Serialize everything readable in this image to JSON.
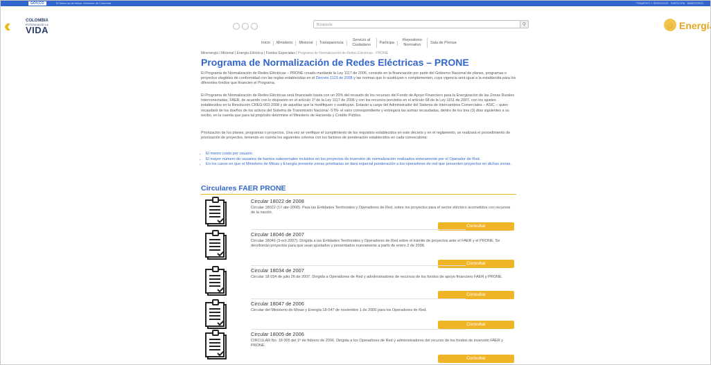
{
  "govbar": {
    "logo": "GOV.CO",
    "message": "El futuro es de todos. Gobierno de Colombia",
    "right": "TRÁMITES Y SERVICIOS · PARTICIPA · MINISTERIO"
  },
  "brand": {
    "line1": "COLOMBIA",
    "line2": "POTENCIA DE LA",
    "line3": "VIDA"
  },
  "search": {
    "placeholder": "Búsqueda"
  },
  "energia": {
    "word": "Energía"
  },
  "nav": [
    {
      "label": "Inicio"
    },
    {
      "label": "Ministerio"
    },
    {
      "label": "Misional"
    },
    {
      "label": "Transparencia"
    },
    {
      "label": "Servicio al Ciudadano"
    },
    {
      "label": "Participa"
    },
    {
      "label": "Repositorio Normativo"
    },
    {
      "label": "Sala de Prensa"
    }
  ],
  "breadcrumb": {
    "path": "Minenergía | Misional | Energía Eléctrica | Fondos Especiales |",
    "current": "Programa de Normalización de Redes Eléctricas - PRONE"
  },
  "page_title": "Programa de Normalización de Redes Eléctricas – PRONE",
  "paragraphs": {
    "p1a": "El Programa de Normalización de Redes Eléctricas – PRONE creado mediante la Ley 1117 de 2006, consiste en la financiación por parte del Gobierno Nacional de planes, programas o proyectos elegibles de conformidad con las reglas establecidas en el",
    "p1link": "Decreto 1123 de 2008",
    "p1b": "y las normas que lo sustituyan o complementen, cuya vigencia será igual a la establecida para los diferentes fondos que financien el Programa.",
    "p2": "El Programa de Normalización de Redes Eléctricas será financiado hasta con un 20% del recaudo de los recursos del Fondo de Apoyo Financiero para la Energización de las Zonas Rurales Interconectadas, FAER, de acuerdo con lo dispuesto en el artículo 1º de la Ley 1117 de 2006 y con los recursos previstos en el artículo 68 de la Ley 1151 de 2007, con los ajustes establecidos en la Resolución CREG-003-2008 y de aquellas que la modifiquen o sustituyan. Estarán a cargo del Administrador del Sistema de Intercambios Comerciales – ASIC – quien recaudará de los dueños de los activos del Sistema de Transmisión Nacional -STN- el valor correspondiente y entregará las sumas recaudadas, dentro de los tres (3) días siguientes a su recibo, en la cuenta que para tal propósito determine el Ministerio de Hacienda y Crédito Público.",
    "p3": "Priorización de los planes, programas o proyectos. Una vez se verifique el cumplimiento de los requisitos establecidos en este decreto y en el reglamento, se realizará el procedimiento de priorización de proyectos, teniendo en cuenta los siguientes criterios con los factores de ponderación establecidos en cada convocatoria:"
  },
  "criteria": [
    "El menor costo por usuario.",
    "El mayor número de usuarios de barrios subnormales incluidos en los proyectos de inversión de normalización realizados enteramente por el Operador de Red.",
    "En los casos en que el Ministerio de Minas y Energía presente zonas prioritarias se dará especial ponderación a los operadores de red que presenten proyectos en dichas zonas."
  ],
  "section_title": "Circulares FAER PRONE",
  "circulars": [
    {
      "title": "Circular 18022 de 2008",
      "description": "Circular 18022 (17-abr-2008). Para las Entidades Territoriales y Operadores de Red, sobre los proyectos para el sector eléctrico acometidos con recursos de la nación.",
      "button": "Consultar"
    },
    {
      "title": "Circular 18046 de 2007",
      "description": "Circular 18046 (3-oct-2007). Dirigida a las Entidades Territoriales y Operadores de Red sobre el trámite de proyectos ante el FAER y el PRONE. Se devolverán proyectos para que sean ajustados y presentados nuevamente a partir de enero 2 de 2008.",
      "button": "Consultar"
    },
    {
      "title": "Circular 18034 de 2007",
      "description": "Circular 18 034 de julio 26 de 2007. Dirigida a Operadores de Red y administradores de recursos de los fondos de apoyo financiero FAER y PRONE.",
      "button": "Consultar"
    },
    {
      "title": "Circular 18047 de 2006",
      "description": "Circular del Ministerio de Minas y Energía 18-047 de noviembre 1 de 2006 para los Operadores de Red.",
      "button": "Consultar"
    },
    {
      "title": "Circular 18005 de 2006",
      "description": "CIRCULAR No. 18 005 del 1º de febrero de 2006. Dirigida a los Operadores de Red y administradores del recurso de los fondos de inversión FAER y PRONE.",
      "button": "Consultar"
    }
  ],
  "colors": {
    "accent": "#3366cc",
    "button": "#f0b429",
    "rule": "#e6b81e"
  },
  "icons": [
    "search-icon",
    "document-list-icon",
    "sun-icon",
    "accessibility-icon"
  ]
}
